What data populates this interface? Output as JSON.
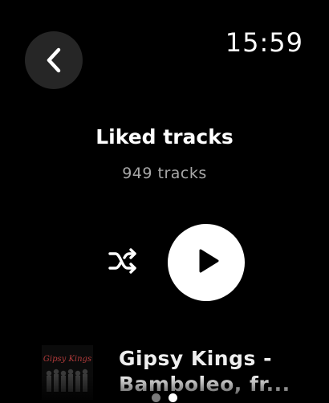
{
  "status_bar": {
    "time": "15:59"
  },
  "navigation": {
    "back_icon": "chevron-left-icon"
  },
  "header": {
    "title": "Liked tracks",
    "track_count": "949 tracks"
  },
  "controls": {
    "shuffle_icon": "shuffle-icon",
    "play_icon": "play-icon"
  },
  "tracks": [
    {
      "artwork_text": "Gipsy Kings",
      "title_line_1": "Gipsy Kings -",
      "title_line_2": "Bamboleo, fr..."
    }
  ],
  "pager": {
    "page_count": 2,
    "current_page": 2
  },
  "colors": {
    "background": "#000000",
    "back_button_bg": "#262626",
    "subtitle": "#a8a8a8",
    "play_button_bg": "#ffffff"
  }
}
